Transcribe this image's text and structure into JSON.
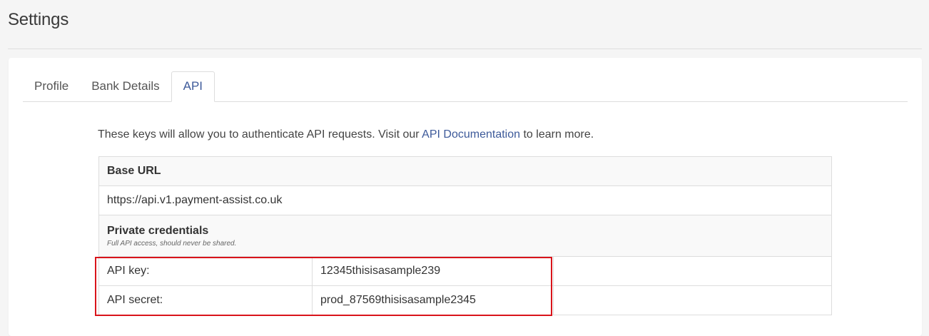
{
  "page": {
    "title": "Settings"
  },
  "tabs": [
    {
      "label": "Profile",
      "active": false
    },
    {
      "label": "Bank Details",
      "active": false
    },
    {
      "label": "API",
      "active": true
    }
  ],
  "intro": {
    "before": "These keys will allow you to authenticate API requests. Visit our ",
    "link": "API Documentation",
    "after": " to learn more."
  },
  "base_url": {
    "heading": "Base URL",
    "value": "https://api.v1.payment-assist.co.uk"
  },
  "private": {
    "heading": "Private credentials",
    "note": "Full API access, should never be shared.",
    "api_key_label": "API key:",
    "api_key_value": "12345thisisasample239",
    "api_secret_label": "API secret:",
    "api_secret_value": "prod_87569thisisasample2345"
  },
  "colors": {
    "accent": "#3d5a9a",
    "highlight": "#d9141b"
  }
}
